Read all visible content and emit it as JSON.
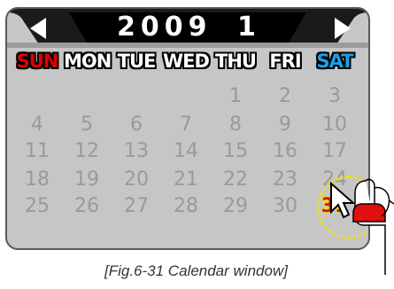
{
  "calendar": {
    "year": "2009",
    "month": "1",
    "weekdays": [
      "SUN",
      "MON",
      "TUE",
      "WED",
      "THU",
      "FRI",
      "SAT"
    ],
    "weeks": [
      [
        "",
        "",
        "",
        "",
        "1",
        "2",
        "3"
      ],
      [
        "4",
        "5",
        "6",
        "7",
        "8",
        "9",
        "10"
      ],
      [
        "11",
        "12",
        "13",
        "14",
        "15",
        "16",
        "17"
      ],
      [
        "18",
        "19",
        "20",
        "21",
        "22",
        "23",
        "24"
      ],
      [
        "25",
        "26",
        "27",
        "28",
        "29",
        "30",
        "31"
      ]
    ],
    "selected_day": "31",
    "colors": {
      "background": "#c6c6c6",
      "header": "#1a1a1a",
      "sunday": "#e00000",
      "saturday": "#1aa0e8",
      "selected": "#e01010",
      "highlight": "#f2e200"
    }
  },
  "icons": {
    "prev": "left-triangle-icon",
    "next": "right-triangle-icon",
    "pointer": "mouse-pointer-icon",
    "hand": "hand-clicking-icon"
  },
  "caption": "[Fig.6-31 Calendar window]"
}
